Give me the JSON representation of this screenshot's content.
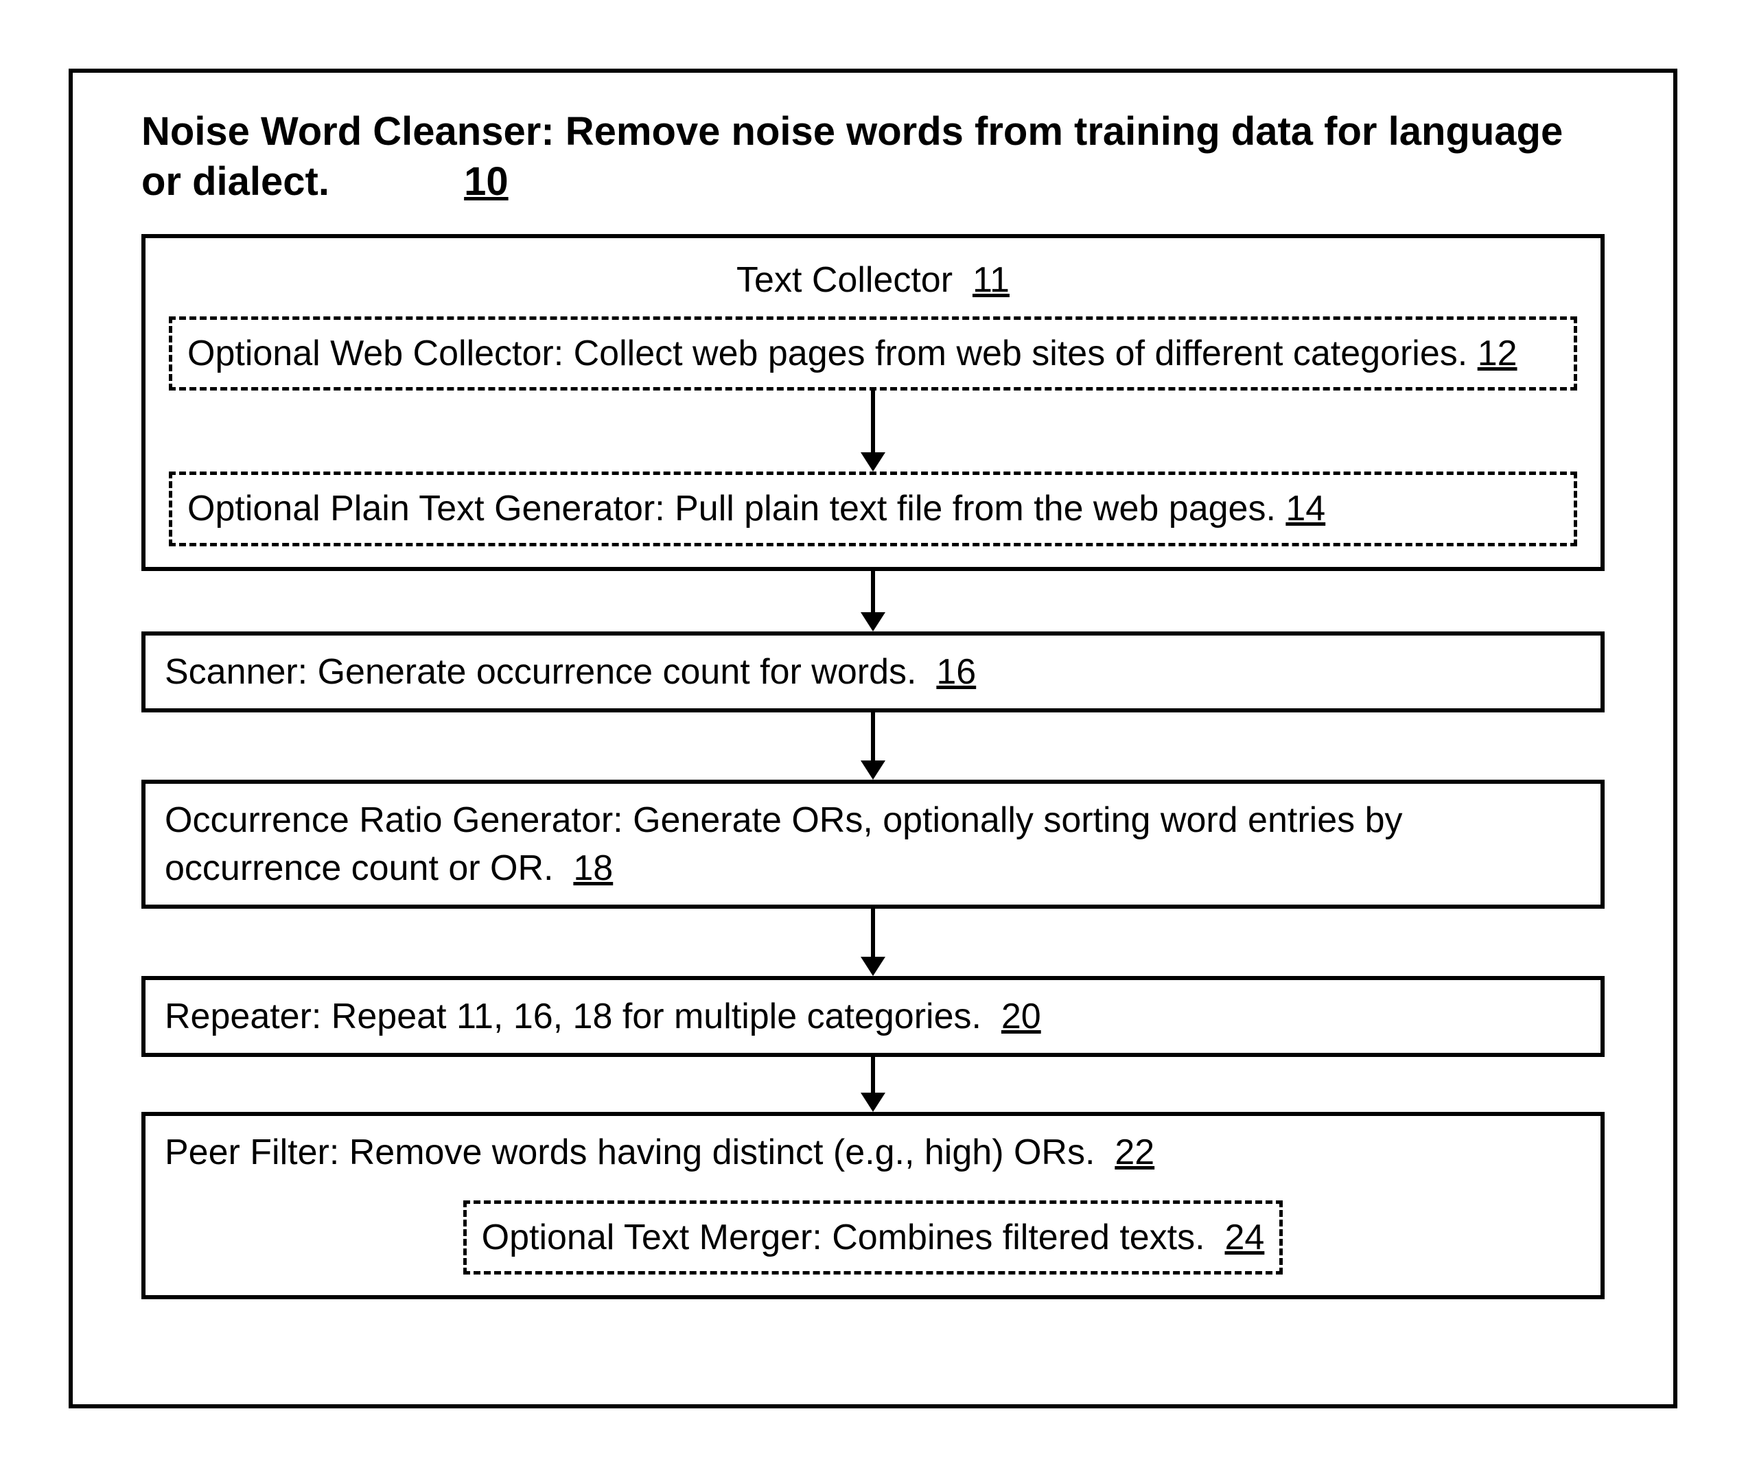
{
  "title": {
    "bold_prefix": "Noise Word Cleanser:",
    "rest": " Remove noise words from training data for language or dialect.",
    "ref": "10"
  },
  "text_collector": {
    "label": "Text Collector",
    "ref": "11",
    "web_collector": {
      "text": "Optional Web Collector: Collect web pages from web sites of different categories.",
      "ref": "12"
    },
    "plain_text_gen": {
      "text": "Optional Plain Text Generator: Pull plain text file from the web pages.",
      "ref": "14"
    }
  },
  "scanner": {
    "text": "Scanner: Generate occurrence count for words.",
    "ref": "16"
  },
  "or_generator": {
    "text": "Occurrence Ratio Generator: Generate ORs, optionally sorting word entries by occurrence count or OR.",
    "ref": "18"
  },
  "repeater": {
    "text": "Repeater: Repeat 11, 16, 18 for multiple categories.",
    "ref": "20"
  },
  "peer_filter": {
    "text": "Peer Filter: Remove words having distinct (e.g., high) ORs.",
    "ref": "22",
    "text_merger": {
      "text": "Optional Text Merger: Combines filtered texts.",
      "ref": "24"
    }
  }
}
